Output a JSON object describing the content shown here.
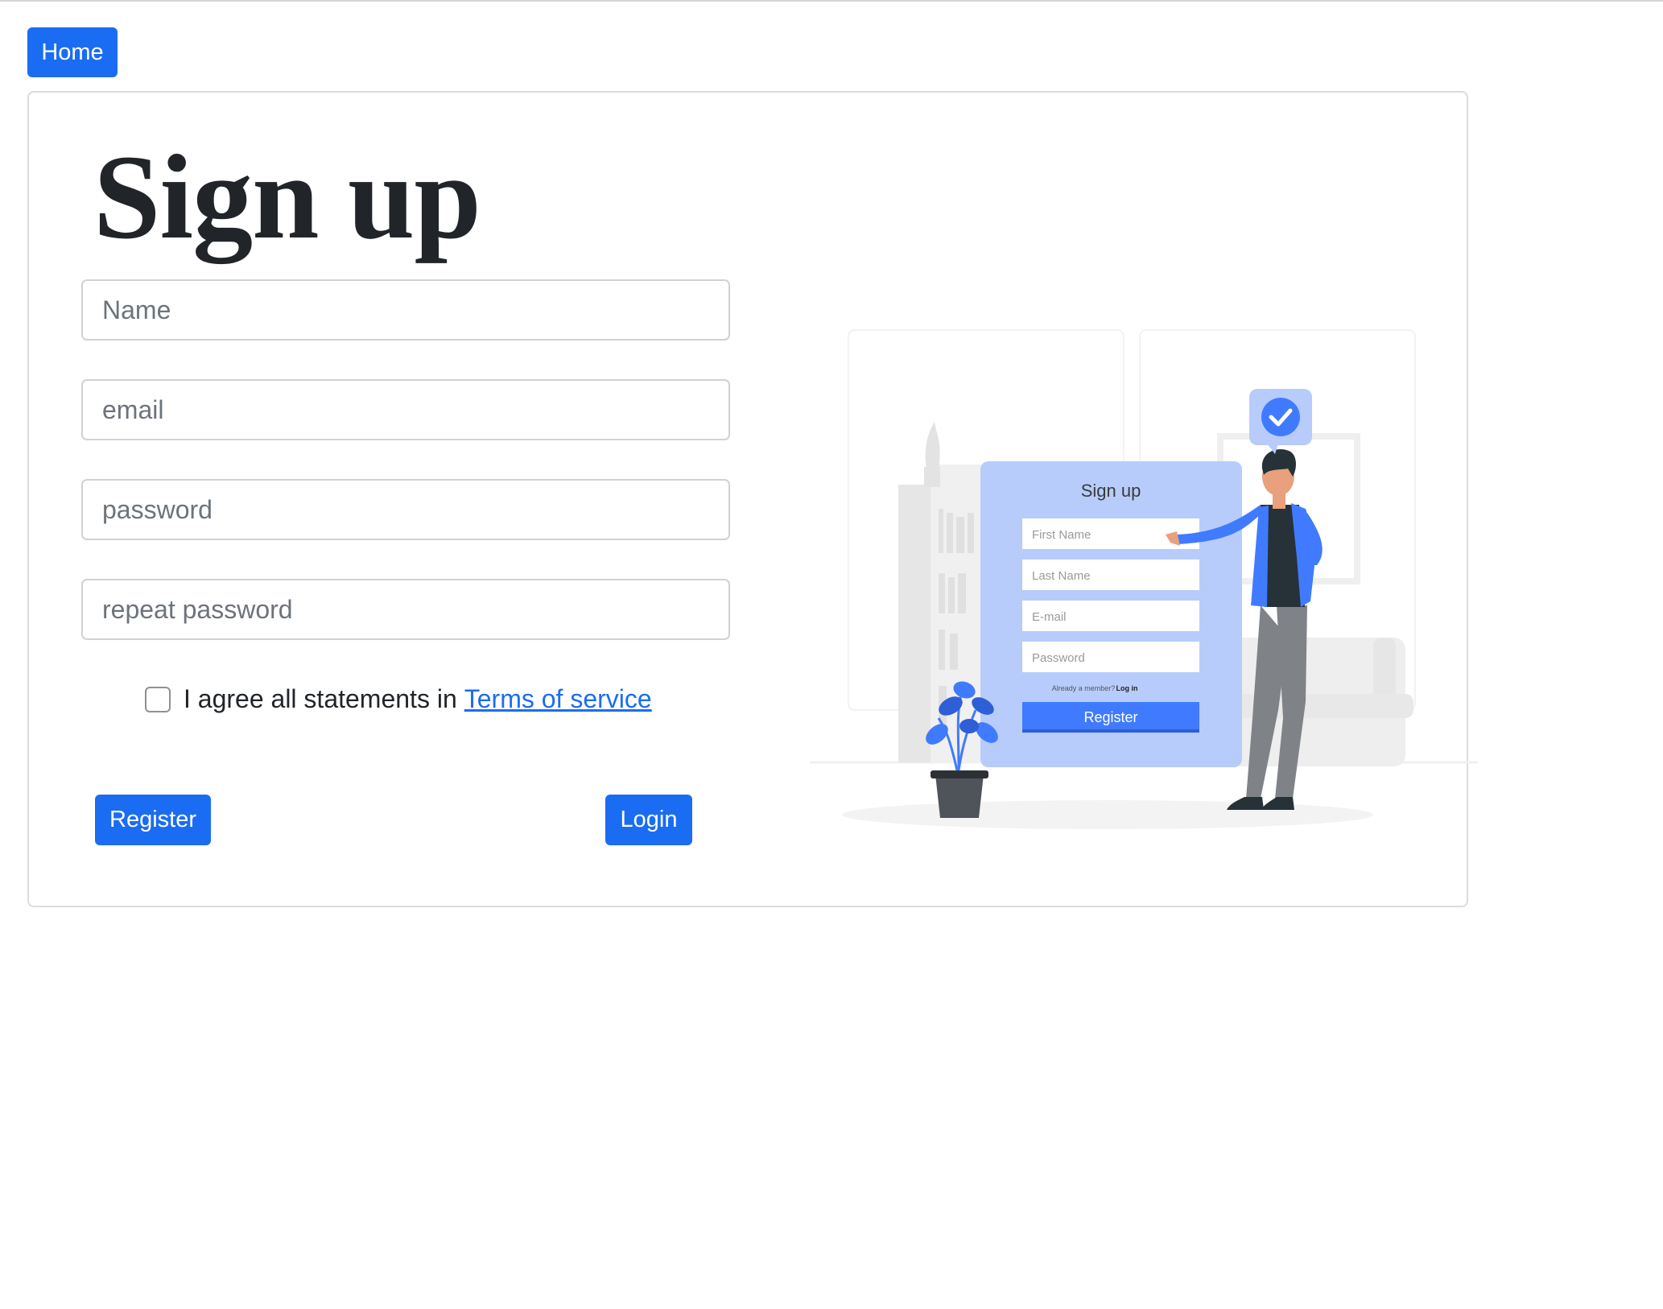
{
  "nav": {
    "home_label": "Home"
  },
  "form": {
    "title": "Sign up",
    "name_placeholder": "Name",
    "email_placeholder": "email",
    "password_placeholder": "password",
    "repeat_password_placeholder": "repeat password",
    "agree_text": "I agree all statements in",
    "terms_link": "Terms of service",
    "register_label": "Register",
    "login_label": "Login"
  },
  "illustration": {
    "card_title": "Sign up",
    "fields": [
      "First Name",
      "Last Name",
      "E-mail",
      "Password"
    ],
    "member_text": "Already a member?",
    "login_text": "Log in",
    "register_label": "Register"
  },
  "colors": {
    "primary": "#1a6df2",
    "illustration_blue": "#407bff",
    "illustration_card": "#b7ccfb"
  }
}
